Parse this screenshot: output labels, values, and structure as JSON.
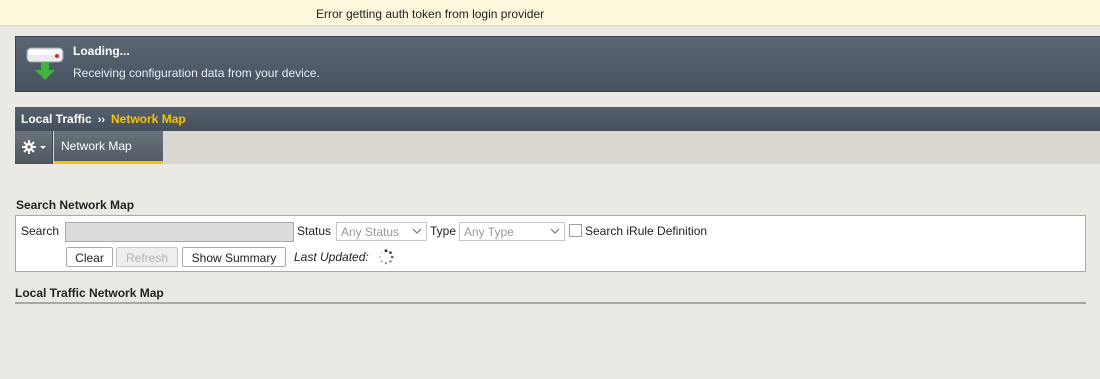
{
  "error_bar": {
    "message": "Error getting auth token from login provider"
  },
  "banner": {
    "icon": "device-download-icon",
    "title": "Loading...",
    "message": "Receiving configuration data from your device."
  },
  "breadcrumb": {
    "parent": "Local Traffic",
    "separator": "››",
    "current": "Network Map",
    "current_color": "#f5c400"
  },
  "tabs": {
    "menu_icon": "gear-icon",
    "items": [
      {
        "label": "Network Map",
        "active": true
      }
    ]
  },
  "search_section": {
    "title": "Search Network Map",
    "search_label": "Search",
    "search_value": "",
    "status_label": "Status",
    "status_selected": "Any Status",
    "type_label": "Type",
    "type_selected": "Any Type",
    "irule_checkbox_label": "Search iRule Definition",
    "irule_checked": false,
    "buttons": {
      "clear": "Clear",
      "refresh": "Refresh",
      "show_summary": "Show Summary"
    },
    "last_updated_label": "Last Updated:"
  },
  "map_section": {
    "title": "Local Traffic Network Map"
  }
}
